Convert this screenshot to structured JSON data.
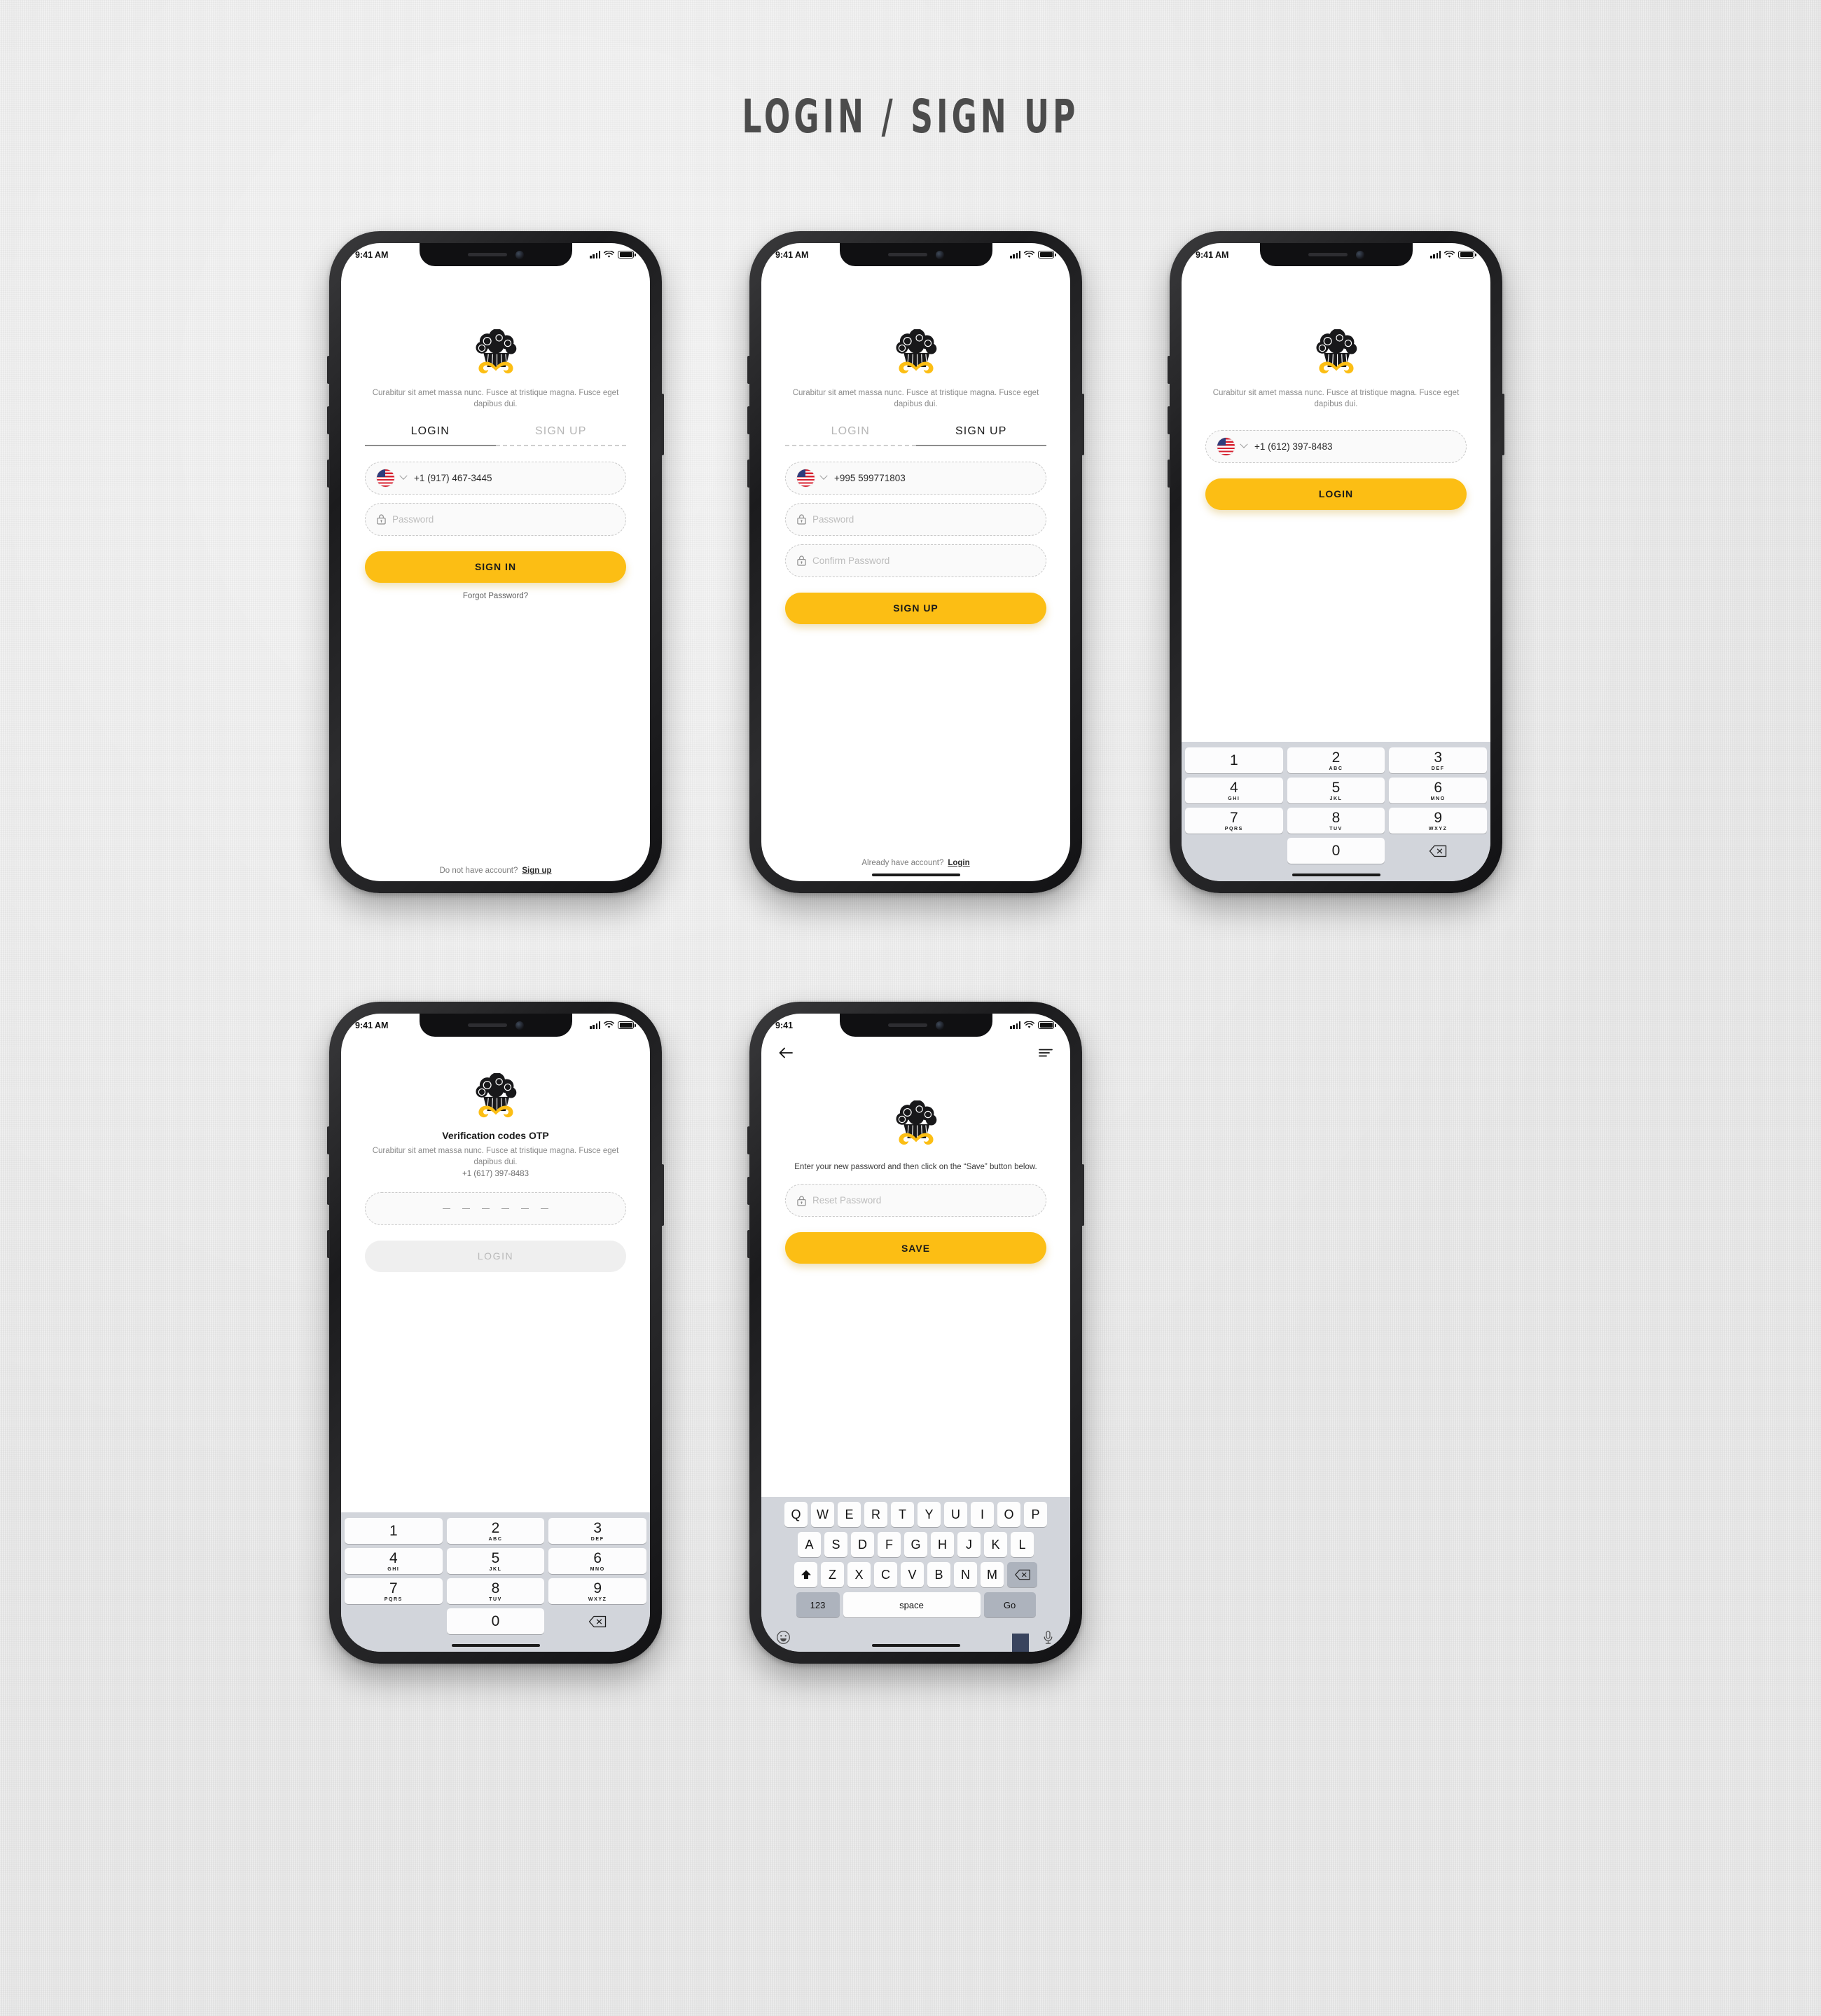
{
  "page": {
    "title": "LOGIN / SIGN UP",
    "background_color": "#e4e4e4",
    "accent_color": "#fcbe14"
  },
  "common": {
    "status_time_am": "9:41 AM",
    "status_time_short": "9:41",
    "tagline": "Curabitur sit amet massa nunc. Fusce at tristique magna. Fusce eget dapibus dui.",
    "logo_name": "cupcake-mustache-logo"
  },
  "screens": [
    {
      "id": "login",
      "name": "login-screen",
      "tabs": [
        {
          "label": "LOGIN",
          "state": "active"
        },
        {
          "label": "SIGN UP",
          "state": "inactive"
        }
      ],
      "phone_field": {
        "value": "+1 (917) 467-3445",
        "country": "US"
      },
      "password_field": {
        "placeholder": "Password",
        "value": ""
      },
      "primary_button": "SIGN IN",
      "forgot_link": "Forgot Password?",
      "footer_text": "Do not have account?",
      "footer_link": "Sign up"
    },
    {
      "id": "signup",
      "name": "signup-screen",
      "tabs": [
        {
          "label": "LOGIN",
          "state": "inactive"
        },
        {
          "label": "SIGN UP",
          "state": "active"
        }
      ],
      "phone_field": {
        "value": "+995 599771803",
        "country": "US"
      },
      "password_field": {
        "placeholder": "Password",
        "value": ""
      },
      "confirm_field": {
        "placeholder": "Confirm Password",
        "value": ""
      },
      "primary_button": "SIGN UP",
      "footer_text": "Already have account?",
      "footer_link": "Login"
    },
    {
      "id": "phone-entry",
      "name": "phone-entry-screen",
      "phone_field": {
        "value": "+1 (612) 397-8483",
        "country": "US"
      },
      "primary_button": "LOGIN"
    },
    {
      "id": "otp",
      "name": "otp-verification-screen",
      "heading": "Verification codes OTP",
      "description": "Curabitur sit amet massa nunc. Fusce at tristique magna. Fusce eget dapibus dui.",
      "phone_number": "+1 (617) 397-8483",
      "otp_slots": 6,
      "primary_button": "LOGIN",
      "primary_button_state": "disabled"
    },
    {
      "id": "reset-password",
      "name": "reset-password-screen",
      "back_icon": "arrow-left-icon",
      "menu_icon": "hamburger-menu-icon",
      "description": "Enter your new password and then click on the “Save” button below.",
      "reset_field": {
        "placeholder": "Reset Password",
        "value": ""
      },
      "primary_button": "SAVE"
    }
  ],
  "numeric_keypad": {
    "rows": [
      [
        {
          "num": "1",
          "sub": ""
        },
        {
          "num": "2",
          "sub": "ABC"
        },
        {
          "num": "3",
          "sub": "DEF"
        }
      ],
      [
        {
          "num": "4",
          "sub": "GHI"
        },
        {
          "num": "5",
          "sub": "JKL"
        },
        {
          "num": "6",
          "sub": "MNO"
        }
      ],
      [
        {
          "num": "7",
          "sub": "PQRS"
        },
        {
          "num": "8",
          "sub": "TUV"
        },
        {
          "num": "9",
          "sub": "WXYZ"
        }
      ]
    ],
    "zero": "0",
    "delete_icon": "backspace-icon"
  },
  "qwerty_keyboard": {
    "row1": [
      "Q",
      "W",
      "E",
      "R",
      "T",
      "Y",
      "U",
      "I",
      "O",
      "P"
    ],
    "row2": [
      "A",
      "S",
      "D",
      "F",
      "G",
      "H",
      "J",
      "K",
      "L"
    ],
    "row3": [
      "Z",
      "X",
      "C",
      "V",
      "B",
      "N",
      "M"
    ],
    "shift_icon": "shift-up-icon",
    "delete_icon": "backspace-icon",
    "numbers_key": "123",
    "space_key": "space",
    "return_key": "Go",
    "emoji_icon": "smiley-face-icon",
    "mic_icon": "microphone-icon"
  }
}
